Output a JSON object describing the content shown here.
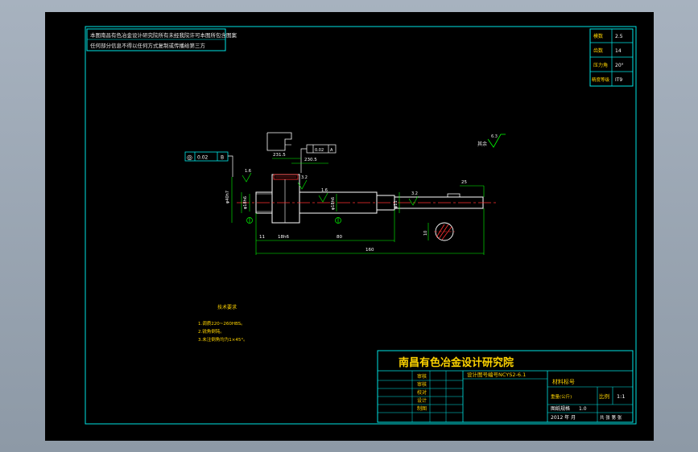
{
  "notice": {
    "line1": "本图南昌有色冶金设计研究院所有未经我院许可本图所包含图案",
    "line2": "任何部分信息不得以任何方式复制或传播给第三方"
  },
  "gear_params": [
    {
      "label": "模数",
      "value": "2.5"
    },
    {
      "label": "齿数",
      "value": "14"
    },
    {
      "label": "压力角",
      "value": "20°"
    },
    {
      "label": "精度等级",
      "value": "IT9"
    }
  ],
  "roughness_note": {
    "label": "其余",
    "value": "6.3"
  },
  "tolerance_frame": {
    "symbol": "◎",
    "value": "0.02",
    "datum": "B"
  },
  "small_frame": {
    "value": "0.02",
    "datum": "A"
  },
  "dimensions": {
    "d231": "231.5",
    "d230": "230.5",
    "d25": "25",
    "d11": "11",
    "d18": "18h6",
    "d80": "80",
    "d160": "160",
    "d10": "10",
    "dia_big": "φ40h7",
    "dia_mid1": "φ18h6",
    "dia_mid2": "φ18h6",
    "dia_small": "φ11",
    "r1": "1.6",
    "r2": "3.2",
    "r3": "1.6",
    "r4": "3.2"
  },
  "tech_requirements": {
    "title": "技术要求",
    "items": [
      "1.调质220~260HBS。",
      "2.锐角倒钝。",
      "3.未注倒角均为1×45°。"
    ]
  },
  "title_block": {
    "company": "南昌有色冶金设计研究院",
    "drawing_no": "设计图号编号NCYS2-6.1",
    "material_label": "材料标号",
    "weight_label": "重量(公斤)",
    "scale_label": "比例",
    "scale_value": "1:1",
    "drawing_label": "图纸规格",
    "version": "1.0",
    "date": "2012 年 月",
    "sheet_label": "共 张 第 张",
    "roles": [
      "审核",
      "审核",
      "校对",
      "设计",
      "制图"
    ]
  }
}
